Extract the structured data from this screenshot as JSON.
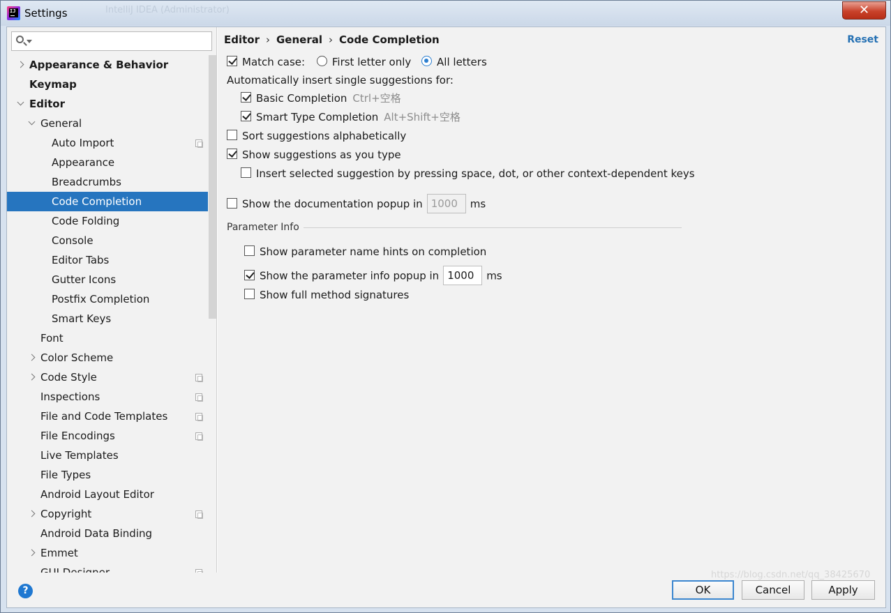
{
  "window": {
    "title": "Settings",
    "background_title": "IntelliJ IDEA (Administrator)",
    "close_symbol": "✕"
  },
  "sidebar": {
    "search_placeholder": "",
    "items": [
      {
        "label": "Appearance & Behavior",
        "level": 0,
        "chevron": "right",
        "bold": true,
        "copy_icon": false,
        "selected": false
      },
      {
        "label": "Keymap",
        "level": 0,
        "chevron": "none",
        "bold": true,
        "copy_icon": false,
        "selected": false
      },
      {
        "label": "Editor",
        "level": 0,
        "chevron": "down",
        "bold": true,
        "copy_icon": false,
        "selected": false
      },
      {
        "label": "General",
        "level": 1,
        "chevron": "down",
        "bold": false,
        "copy_icon": false,
        "selected": false
      },
      {
        "label": "Auto Import",
        "level": 2,
        "chevron": "none",
        "bold": false,
        "copy_icon": true,
        "selected": false
      },
      {
        "label": "Appearance",
        "level": 2,
        "chevron": "none",
        "bold": false,
        "copy_icon": false,
        "selected": false
      },
      {
        "label": "Breadcrumbs",
        "level": 2,
        "chevron": "none",
        "bold": false,
        "copy_icon": false,
        "selected": false
      },
      {
        "label": "Code Completion",
        "level": 2,
        "chevron": "none",
        "bold": false,
        "copy_icon": false,
        "selected": true
      },
      {
        "label": "Code Folding",
        "level": 2,
        "chevron": "none",
        "bold": false,
        "copy_icon": false,
        "selected": false
      },
      {
        "label": "Console",
        "level": 2,
        "chevron": "none",
        "bold": false,
        "copy_icon": false,
        "selected": false
      },
      {
        "label": "Editor Tabs",
        "level": 2,
        "chevron": "none",
        "bold": false,
        "copy_icon": false,
        "selected": false
      },
      {
        "label": "Gutter Icons",
        "level": 2,
        "chevron": "none",
        "bold": false,
        "copy_icon": false,
        "selected": false
      },
      {
        "label": "Postfix Completion",
        "level": 2,
        "chevron": "none",
        "bold": false,
        "copy_icon": false,
        "selected": false
      },
      {
        "label": "Smart Keys",
        "level": 2,
        "chevron": "none",
        "bold": false,
        "copy_icon": false,
        "selected": false
      },
      {
        "label": "Font",
        "level": 1,
        "chevron": "none",
        "bold": false,
        "copy_icon": false,
        "selected": false
      },
      {
        "label": "Color Scheme",
        "level": 1,
        "chevron": "right",
        "bold": false,
        "copy_icon": false,
        "selected": false
      },
      {
        "label": "Code Style",
        "level": 1,
        "chevron": "right",
        "bold": false,
        "copy_icon": true,
        "selected": false
      },
      {
        "label": "Inspections",
        "level": 1,
        "chevron": "none",
        "bold": false,
        "copy_icon": true,
        "selected": false
      },
      {
        "label": "File and Code Templates",
        "level": 1,
        "chevron": "none",
        "bold": false,
        "copy_icon": true,
        "selected": false
      },
      {
        "label": "File Encodings",
        "level": 1,
        "chevron": "none",
        "bold": false,
        "copy_icon": true,
        "selected": false
      },
      {
        "label": "Live Templates",
        "level": 1,
        "chevron": "none",
        "bold": false,
        "copy_icon": false,
        "selected": false
      },
      {
        "label": "File Types",
        "level": 1,
        "chevron": "none",
        "bold": false,
        "copy_icon": false,
        "selected": false
      },
      {
        "label": "Android Layout Editor",
        "level": 1,
        "chevron": "none",
        "bold": false,
        "copy_icon": false,
        "selected": false
      },
      {
        "label": "Copyright",
        "level": 1,
        "chevron": "right",
        "bold": false,
        "copy_icon": true,
        "selected": false
      },
      {
        "label": "Android Data Binding",
        "level": 1,
        "chevron": "none",
        "bold": false,
        "copy_icon": false,
        "selected": false
      },
      {
        "label": "Emmet",
        "level": 1,
        "chevron": "right",
        "bold": false,
        "copy_icon": false,
        "selected": false
      },
      {
        "label": "GUI Designer",
        "level": 1,
        "chevron": "none",
        "bold": false,
        "copy_icon": true,
        "selected": false
      }
    ]
  },
  "main": {
    "breadcrumb": [
      "Editor",
      "General",
      "Code Completion"
    ],
    "breadcrumb_sep": "›",
    "reset_label": "Reset",
    "match_case": {
      "label": "Match case:",
      "checked": true,
      "option_first": "First letter only",
      "option_all": "All letters",
      "selected": "All letters"
    },
    "auto_insert_label": "Automatically insert single suggestions for:",
    "basic_completion": {
      "label": "Basic Completion",
      "shortcut": "Ctrl+空格",
      "checked": true
    },
    "smart_completion": {
      "label": "Smart Type Completion",
      "shortcut": "Alt+Shift+空格",
      "checked": true
    },
    "sort_alpha": {
      "label": "Sort suggestions alphabetically",
      "checked": false
    },
    "show_as_type": {
      "label": "Show suggestions as you type",
      "checked": true
    },
    "insert_selected": {
      "label": "Insert selected suggestion by pressing space, dot, or other context-dependent keys",
      "checked": false
    },
    "doc_popup": {
      "label": "Show the documentation popup in",
      "value": "1000",
      "unit": "ms",
      "checked": false
    },
    "param_section_title": "Parameter Info",
    "param_hints": {
      "label": "Show parameter name hints on completion",
      "checked": false
    },
    "param_popup": {
      "label": "Show the parameter info popup in",
      "value": "1000",
      "unit": "ms",
      "checked": true
    },
    "full_signatures": {
      "label": "Show full method signatures",
      "checked": false
    }
  },
  "footer": {
    "help_label": "?",
    "ok_label": "OK",
    "cancel_label": "Cancel",
    "apply_label": "Apply",
    "watermark": "https://blog.csdn.net/qq_38425670"
  },
  "colors": {
    "selection": "#2675bf",
    "link": "#2470b3",
    "close_button": "#c9422b",
    "help": "#1f78d1"
  }
}
